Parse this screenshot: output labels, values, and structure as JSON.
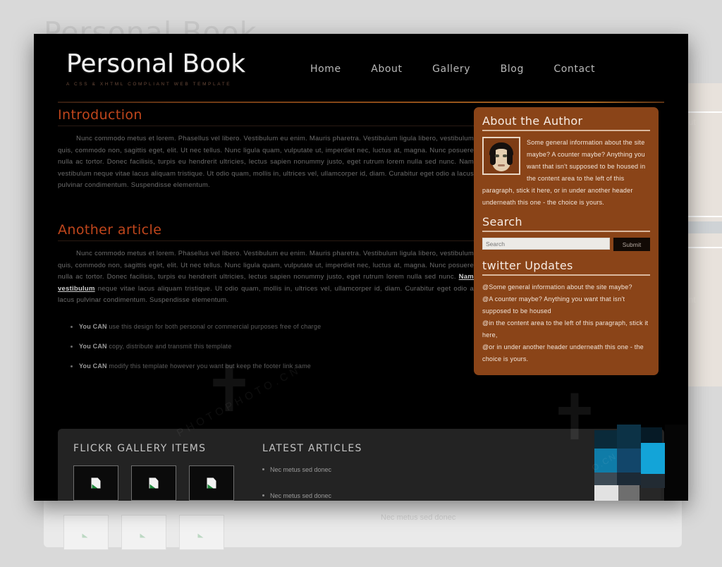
{
  "site": {
    "brand_title": "Personal Book",
    "brand_tagline": "A CSS & XHTML COMPLIANT WEB TEMPLATE",
    "accent_color": "#c0461c",
    "sidebar_color": "#8a4418",
    "panel_background": "#000000",
    "page_background": "#d9d9d9"
  },
  "nav": {
    "items": [
      {
        "label": "Home"
      },
      {
        "label": "About"
      },
      {
        "label": "Gallery"
      },
      {
        "label": "Blog"
      },
      {
        "label": "Contact"
      }
    ]
  },
  "articles": [
    {
      "heading": "Introduction",
      "body_before": "Nunc commodo metus et lorem. Phasellus vel libero. Vestibulum eu enim. Mauris pharetra. Vestibulum ligula libero, vestibulum quis, commodo non, sagittis eget, elit. Ut nec tellus. Nunc ligula quam, vulputate ut, imperdiet nec, luctus at, magna. Nunc posuere nulla ac tortor. Donec facilisis, turpis eu hendrerit ultricies, lectus sapien nonummy justo, eget rutrum lorem nulla sed nunc. Nam vestibulum neque vitae lacus aliquam tristique. Ut odio quam, mollis in, ultrices vel, ullamcorper id, diam. Curabitur eget odio a lacus pulvinar condimentum. Suspendisse elementum.",
      "link_text": "",
      "body_after": ""
    },
    {
      "heading": "Another article",
      "body_before": "Nunc commodo metus et lorem. Phasellus vel libero. Vestibulum eu enim. Mauris pharetra. Vestibulum ligula libero, vestibulum quis, commodo non, sagittis eget, elit. Ut nec tellus. Nunc ligula quam, vulputate ut, imperdiet nec, luctus at, magna. Nunc posuere nulla ac tortor. Donec facilisis, turpis eu hendrerit ultricies, lectus sapien nonummy justo, eget rutrum lorem nulla sed nunc. ",
      "link_text": "Nam vestibulum",
      "body_after": " neque vitae lacus aliquam tristique. Ut odio quam, mollis in, ultrices vel, ullamcorper id, diam. Curabitur eget odio a lacus pulvinar condimentum. Suspendisse elementum."
    }
  ],
  "permissions": [
    {
      "strong": "You CAN",
      "rest": " use this design for both personal or commercial purposes free of charge"
    },
    {
      "strong": "You CAN",
      "rest": " copy, distribute and transmit this template"
    },
    {
      "strong": "You CAN",
      "rest": " modify this template however you want but keep the footer link same"
    }
  ],
  "sidebar": {
    "author": {
      "heading": "About the Author",
      "avatar_icon": "author-face-avatar",
      "text": "Some general information about the site maybe? A counter maybe? Anything you want that isn't supposed to be housed in the content area to the left of this paragraph, stick it here, or in under another header underneath this one - the choice is yours."
    },
    "search": {
      "heading": "Search",
      "placeholder": "Search",
      "value": "",
      "submit_label": "Submit"
    },
    "twitter": {
      "heading": "twitter Updates",
      "items": [
        "@Some general information about the site maybe?",
        "@A counter maybe? Anything you want that isn't supposed to be housed",
        "@in the content area to the left of this paragraph, stick it here,",
        "@or in under another header underneath this one - the choice is yours."
      ]
    }
  },
  "footer": {
    "flickr": {
      "heading": "FLICKR GALLERY ITEMS",
      "thumbs": [
        {
          "icon": "broken-image-icon"
        },
        {
          "icon": "broken-image-icon"
        },
        {
          "icon": "broken-image-icon"
        }
      ]
    },
    "latest": {
      "heading": "LATEST ARTICLES",
      "items": [
        "Nec metus sed donec",
        "Nec metus sed donec"
      ]
    }
  },
  "watermarks": {
    "photo_text": "PHOTOPHOTO.CN",
    "cn_text": "O.CN",
    "dove_icon": "dove-watermark-icon"
  }
}
